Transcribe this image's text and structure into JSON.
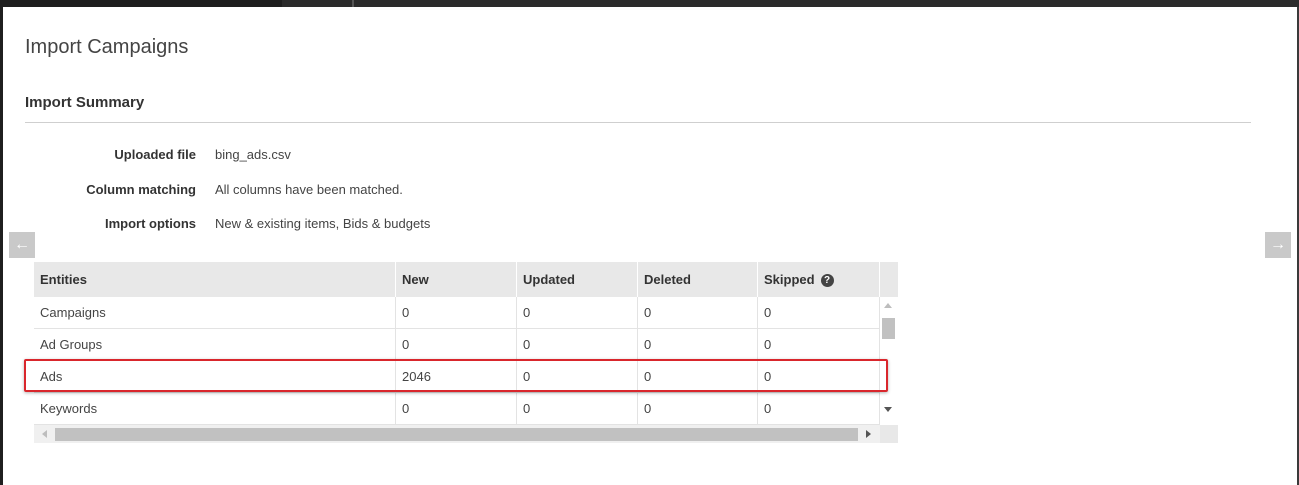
{
  "page": {
    "title": "Import Campaigns",
    "section_title": "Import Summary"
  },
  "summary": [
    {
      "label": "Uploaded file",
      "value": "bing_ads.csv"
    },
    {
      "label": "Column matching",
      "value": "All columns have been matched."
    },
    {
      "label": "Import options",
      "value": "New & existing items, Bids & budgets"
    }
  ],
  "nav": {
    "prev_icon": "arrow-left-icon",
    "prev_glyph": "←",
    "next_icon": "arrow-right-icon",
    "next_glyph": "→"
  },
  "table": {
    "columns": [
      "Entities",
      "New",
      "Updated",
      "Deleted",
      "Skipped"
    ],
    "help_icon": "question-circle-icon",
    "help_glyph": "?",
    "rows": [
      {
        "entity": "Campaigns",
        "new": "0",
        "updated": "0",
        "deleted": "0",
        "skipped": "0"
      },
      {
        "entity": "Ad Groups",
        "new": "0",
        "updated": "0",
        "deleted": "0",
        "skipped": "0"
      },
      {
        "entity": "Ads",
        "new": "2046",
        "updated": "0",
        "deleted": "0",
        "skipped": "0"
      },
      {
        "entity": "Keywords",
        "new": "0",
        "updated": "0",
        "deleted": "0",
        "skipped": "0"
      }
    ],
    "highlighted_row": "Ads"
  },
  "colors": {
    "highlight_border": "#d9262c",
    "header_bg": "#e8e8e8",
    "nav_arrow_bg": "#c9c9c9"
  }
}
